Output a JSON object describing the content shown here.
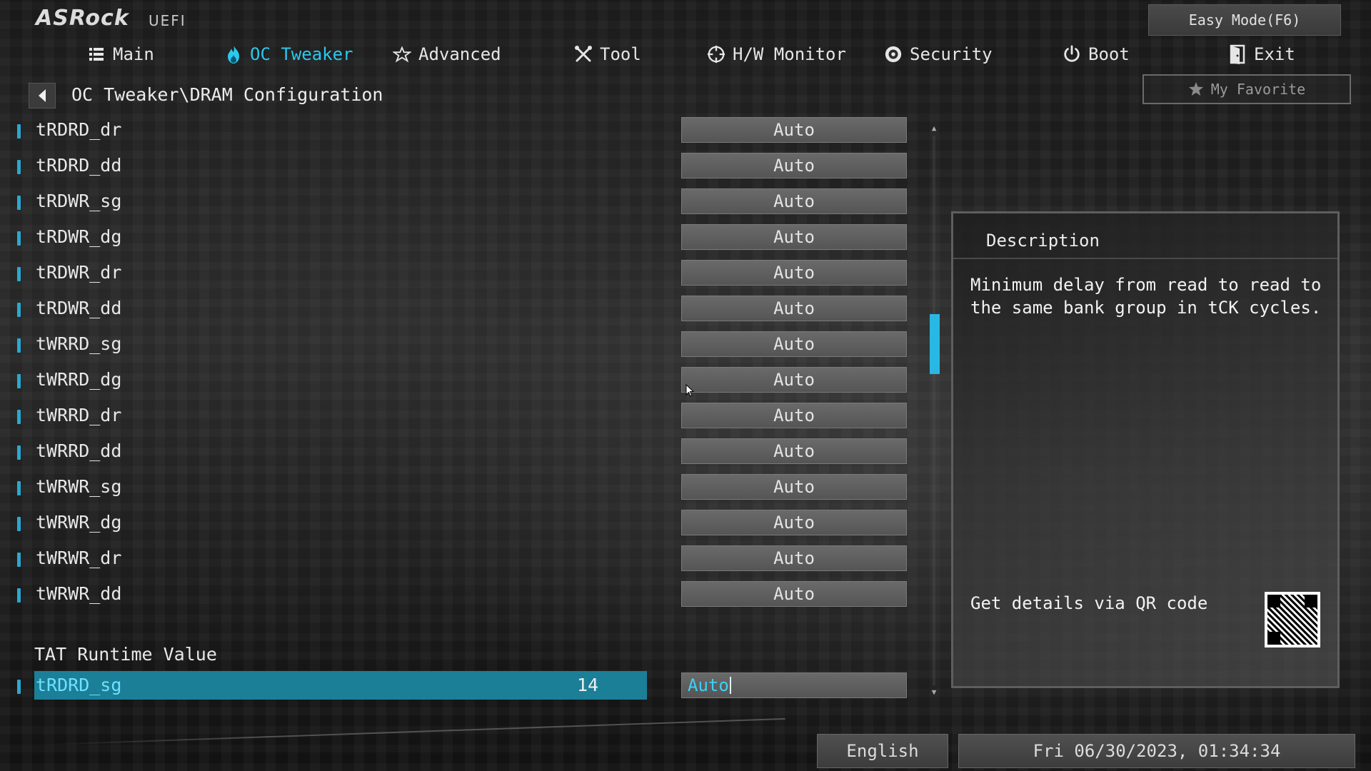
{
  "header": {
    "logo": "ASRock",
    "logo_sub": "UEFI",
    "easy_mode": "Easy Mode(F6)",
    "my_favorite": "My Favorite"
  },
  "nav": {
    "tabs": [
      {
        "label": "Main",
        "icon": "list-icon"
      },
      {
        "label": "OC Tweaker",
        "icon": "flame-icon",
        "active": true
      },
      {
        "label": "Advanced",
        "icon": "star-icon"
      },
      {
        "label": "Tool",
        "icon": "tools-icon"
      },
      {
        "label": "H/W Monitor",
        "icon": "crosshair-icon"
      },
      {
        "label": "Security",
        "icon": "shield-icon"
      },
      {
        "label": "Boot",
        "icon": "power-icon"
      },
      {
        "label": "Exit",
        "icon": "door-icon"
      }
    ]
  },
  "breadcrumb": "OC Tweaker\\DRAM Configuration",
  "settings": [
    {
      "label": "tRDRD_dr",
      "value": "Auto"
    },
    {
      "label": "tRDRD_dd",
      "value": "Auto"
    },
    {
      "label": "tRDWR_sg",
      "value": "Auto"
    },
    {
      "label": "tRDWR_dg",
      "value": "Auto"
    },
    {
      "label": "tRDWR_dr",
      "value": "Auto"
    },
    {
      "label": "tRDWR_dd",
      "value": "Auto"
    },
    {
      "label": "tWRRD_sg",
      "value": "Auto"
    },
    {
      "label": "tWRRD_dg",
      "value": "Auto"
    },
    {
      "label": "tWRRD_dr",
      "value": "Auto"
    },
    {
      "label": "tWRRD_dd",
      "value": "Auto"
    },
    {
      "label": "tWRWR_sg",
      "value": "Auto"
    },
    {
      "label": "tWRWR_dg",
      "value": "Auto"
    },
    {
      "label": "tWRWR_dr",
      "value": "Auto"
    },
    {
      "label": "tWRWR_dd",
      "value": "Auto"
    }
  ],
  "section_title": "TAT Runtime Value",
  "selected_setting": {
    "label": "tRDRD_sg",
    "runtime": "14",
    "value": "Auto"
  },
  "description": {
    "title": "Description",
    "text": "Minimum delay from read to read to the same bank group in tCK cycles.",
    "qr_hint": "Get details via QR code"
  },
  "footer": {
    "language": "English",
    "datetime": "Fri 06/30/2023, 01:34:34"
  },
  "colors": {
    "accent": "#2bc8ee",
    "selected_row": "#1b7f98",
    "scroll_thumb": "#29b8e4"
  }
}
